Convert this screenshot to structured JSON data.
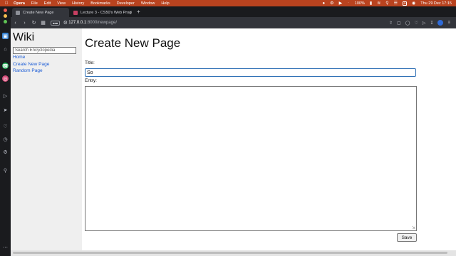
{
  "menubar": {
    "app": "Opera",
    "items": [
      "File",
      "Edit",
      "View",
      "History",
      "Bookmarks",
      "Developer",
      "Window",
      "Help"
    ],
    "battery": "100%",
    "input_source": "A",
    "datetime": "Thu 29 Dec  17:15"
  },
  "tabs": [
    {
      "label": "Create New Page",
      "active": true
    },
    {
      "label": "Lecture 3 - CS50's Web Progr...",
      "active": false
    }
  ],
  "address": {
    "host": "127.0.0.1",
    "path": ":8000/newpage/"
  },
  "page": {
    "site_title": "Wiki",
    "search_placeholder": "Search Encyclopedia",
    "nav": [
      "Home",
      "Create New Page",
      "Random Page"
    ],
    "heading": "Create New Page",
    "title_label": "Title:",
    "title_value": "So",
    "entry_label": "Entry:",
    "entry_value": "",
    "save_label": "Save"
  },
  "colors": {
    "menubar": "#b9431f",
    "link": "#1a5bd6",
    "focus": "#2f70b5",
    "sidebar_bg": "#efefef"
  }
}
